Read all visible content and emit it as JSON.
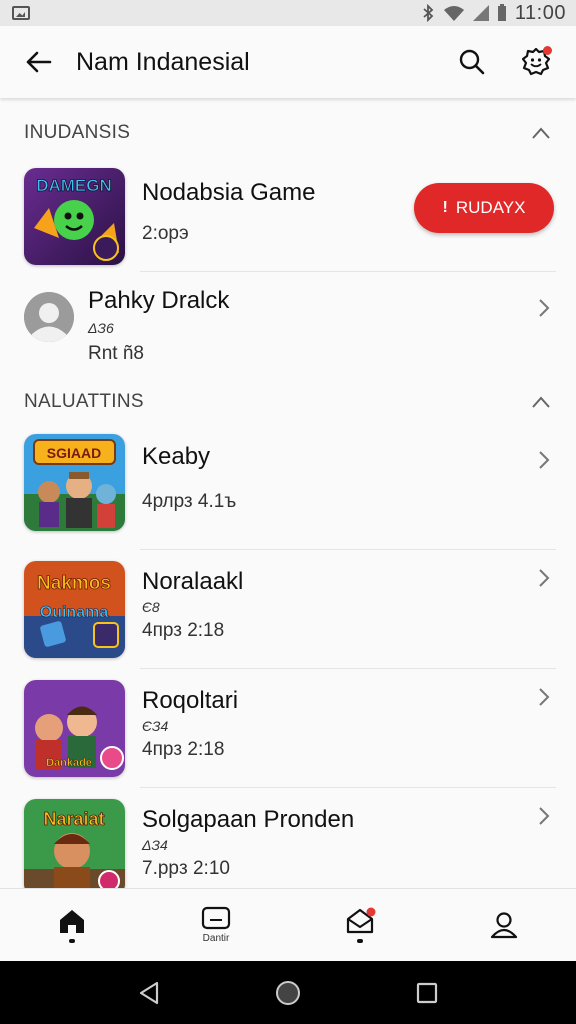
{
  "status_bar": {
    "time": "11:00"
  },
  "app_bar": {
    "title": "Nam Indanesial"
  },
  "sections": [
    {
      "title": "INUDANSIS",
      "items": [
        {
          "title": "Nodabsia Game",
          "subtitle": "2:oрэ",
          "button_label": "RUDAYX",
          "thumb_text": "DAMEGN"
        },
        {
          "title": "Pahky Dralck",
          "small": "ΔЗ6",
          "subtitle": "Rnt  ñ8"
        }
      ]
    },
    {
      "title": "NALUATTINS",
      "items": [
        {
          "title": "Keaby",
          "subtitle": "4рлрз  4.1ъ",
          "thumb_text": "SGIAAD"
        },
        {
          "title": "Noralaakl",
          "small": "Є8",
          "subtitle": "4прз  2:18",
          "thumb_text": "Nakmos"
        },
        {
          "title": "Roqoltari",
          "small": "ЄЗ4",
          "subtitle": "4пpз  2:18",
          "thumb_text": "Dankade"
        },
        {
          "title": "Solgapaan Pronden",
          "small": "ΔЗ4",
          "subtitle": "7.рpз  2:10",
          "thumb_text": "Naraiat"
        }
      ]
    }
  ],
  "bottom_nav": {
    "item2_label": "Dantir"
  },
  "colors": {
    "accent_red": "#e02828",
    "background": "#fafafa",
    "divider": "#e4e4e4"
  }
}
